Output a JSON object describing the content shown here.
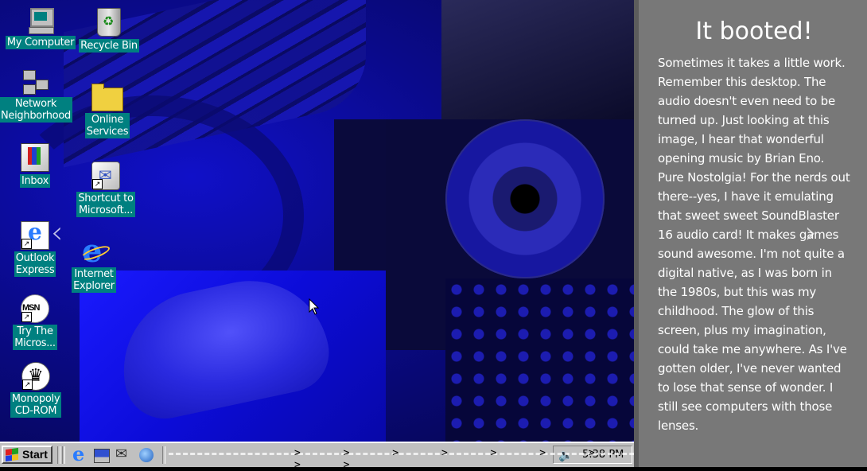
{
  "desktop": {
    "icons": [
      {
        "label": "My Computer",
        "icon": "my-computer-icon"
      },
      {
        "label": "Recycle Bin",
        "icon": "recycle-bin-icon"
      },
      {
        "label": "Network Neighborhood",
        "line1": "Network",
        "line2": "Neighborhood",
        "icon": "network-neighborhood-icon"
      },
      {
        "label": "Online Services",
        "line1": "Online",
        "line2": "Services",
        "icon": "folder-icon"
      },
      {
        "label": "Inbox",
        "icon": "inbox-icon"
      },
      {
        "label": "Shortcut to Microsoft...",
        "line1": "Shortcut to",
        "line2": "Microsoft...",
        "icon": "microsoft-tools-icon"
      },
      {
        "label": "Outlook Express",
        "line1": "Outlook",
        "line2": "Express",
        "icon": "outlook-express-icon"
      },
      {
        "label": "Internet Explorer",
        "line1": "Internet",
        "line2": "Explorer",
        "icon": "internet-explorer-icon"
      },
      {
        "label": "Try The Micros...",
        "line1": "Try The",
        "line2": "Micros...",
        "icon": "msn-icon"
      },
      {
        "label": "Monopoly CD-ROM",
        "line1": "Monopoly",
        "line2": "CD-ROM",
        "icon": "monopoly-icon"
      }
    ]
  },
  "taskbar": {
    "start_label": "Start",
    "quick_launch": [
      "internet-explorer-icon",
      "show-desktop-icon",
      "outlook-icon",
      "channels-icon"
    ],
    "clock": "5:38 PM",
    "tray_icon": "speaker-icon",
    "dash_arrows": "> > > > > > > > > > > > > >"
  },
  "panel": {
    "title": "It booted!",
    "body": "Sometimes it takes a little work. Remember this desktop. The audio doesn't even need to be turned up. Just looking at this image, I hear that wonderful opening music by Brian Eno. Pure Nostolgia! For the nerds out there--yes, I have it emulating that sweet sweet SoundBlaster 16 audio card! It makes games sound awesome. I'm not quite a digital native, as I was born in the 1980s, but this was my childhood. The glow of this screen, plus my imagination, could take me anywhere. As I've gotten older, I've never wanted to lose that sense of wonder. I still see computers with those lenses."
  },
  "nav": {
    "prev": "‹",
    "next": "›"
  },
  "colors": {
    "desktop_blue": "#0a0aa0",
    "icon_label_bg": "#008080",
    "panel_bg": "#787878",
    "taskbar_bg": "#c0c0c0"
  }
}
